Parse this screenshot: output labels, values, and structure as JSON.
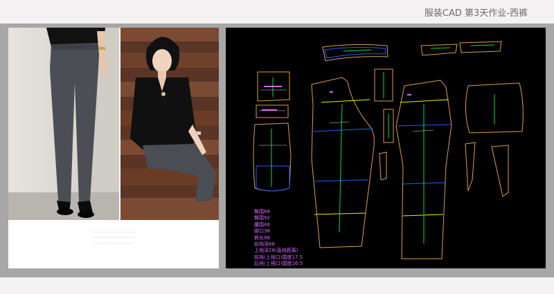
{
  "header": {
    "title": "服装CAD 第3天作业-西裤"
  },
  "photo": {
    "caption_lines": [
      "·····················································",
      "···············································",
      "·············································"
    ]
  },
  "measurements": [
    "臀围68",
    "臀围92",
    "腰围46",
    "脚口38",
    "裤长98",
    "前裆深68",
    "上裆深28(直线距离)",
    "前裆(上裆口)围度17.5",
    "后裆(上裆口)围度16.5"
  ],
  "colors": {
    "outline": "#e0a040",
    "grain": "#00e040",
    "waistband": "#2060ff",
    "notch": "#f0f000",
    "label": "#d66bff"
  }
}
